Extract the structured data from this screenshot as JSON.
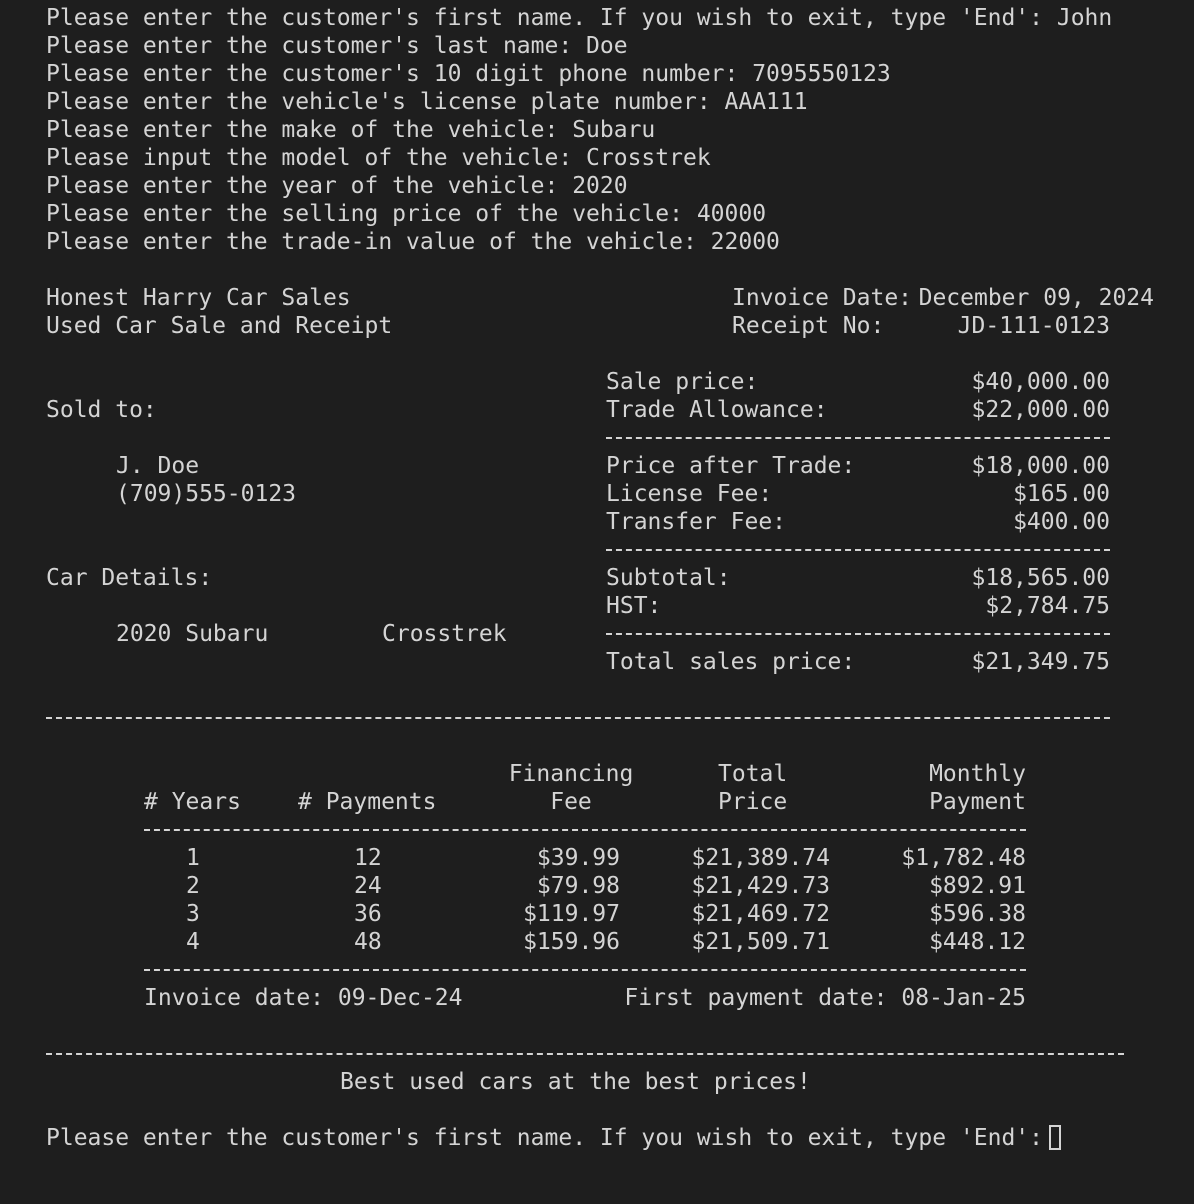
{
  "prompts": [
    {
      "text": "Please enter the customer's first name. If you wish to exit, type 'End': John"
    },
    {
      "text": "Please enter the customer's last name: Doe"
    },
    {
      "text": "Please enter the customer's 10 digit phone number: 7095550123"
    },
    {
      "text": "Please enter the vehicle's license plate number: AAA111"
    },
    {
      "text": "Please enter the make of the vehicle: Subaru"
    },
    {
      "text": "Please input the model of the vehicle: Crosstrek"
    },
    {
      "text": "Please enter the year of the vehicle: 2020"
    },
    {
      "text": "Please enter the selling price of the vehicle: 40000"
    },
    {
      "text": "Please enter the trade-in value of the vehicle: 22000"
    }
  ],
  "header": {
    "company": "Honest Harry Car Sales",
    "subtitle": "Used Car Sale and Receipt",
    "invoice_date_label": "Invoice Date:",
    "invoice_date": "December 09, 2024",
    "receipt_label": "Receipt No:",
    "receipt_no": "JD-111-0123"
  },
  "customer": {
    "sold_to_label": "Sold to:",
    "name": "J. Doe",
    "phone": "(709)555-0123"
  },
  "car": {
    "details_label": "Car Details:",
    "year_make": "2020 Subaru",
    "model": "Crosstrek"
  },
  "summary": [
    {
      "label": "Sale price:",
      "value": "$40,000.00"
    },
    {
      "label": "Trade Allowance:",
      "value": "$22,000.00"
    },
    {
      "label": "Price after Trade:",
      "value": "$18,000.00"
    },
    {
      "label": "License Fee:",
      "value": "$165.00"
    },
    {
      "label": "Transfer Fee:",
      "value": "$400.00"
    },
    {
      "label": "Subtotal:",
      "value": "$18,565.00"
    },
    {
      "label": "HST:",
      "value": "$2,784.75"
    },
    {
      "label": "Total sales price:",
      "value": "$21,349.75"
    }
  ],
  "financing": {
    "headers": {
      "years": "# Years",
      "payments": "# Payments",
      "fee_top": "Financing",
      "fee_bottom": "Fee",
      "total_top": "Total",
      "total_bottom": "Price",
      "monthly_top": "Monthly",
      "monthly_bottom": "Payment"
    },
    "rows": [
      {
        "years": "1",
        "payments": "12",
        "fee": "$39.99",
        "total": "$21,389.74",
        "monthly": "$1,782.48"
      },
      {
        "years": "2",
        "payments": "24",
        "fee": "$79.98",
        "total": "$21,429.73",
        "monthly": "$892.91"
      },
      {
        "years": "3",
        "payments": "36",
        "fee": "$119.97",
        "total": "$21,469.72",
        "monthly": "$596.38"
      },
      {
        "years": "4",
        "payments": "48",
        "fee": "$159.96",
        "total": "$21,509.71",
        "monthly": "$448.12"
      }
    ],
    "invoice_date": "Invoice date: 09-Dec-24",
    "first_payment": "First payment date: 08-Jan-25"
  },
  "footer": {
    "slogan": "Best used cars at the best prices!",
    "next_prompt": "Please enter the customer's first name. If you wish to exit, type 'End':"
  }
}
